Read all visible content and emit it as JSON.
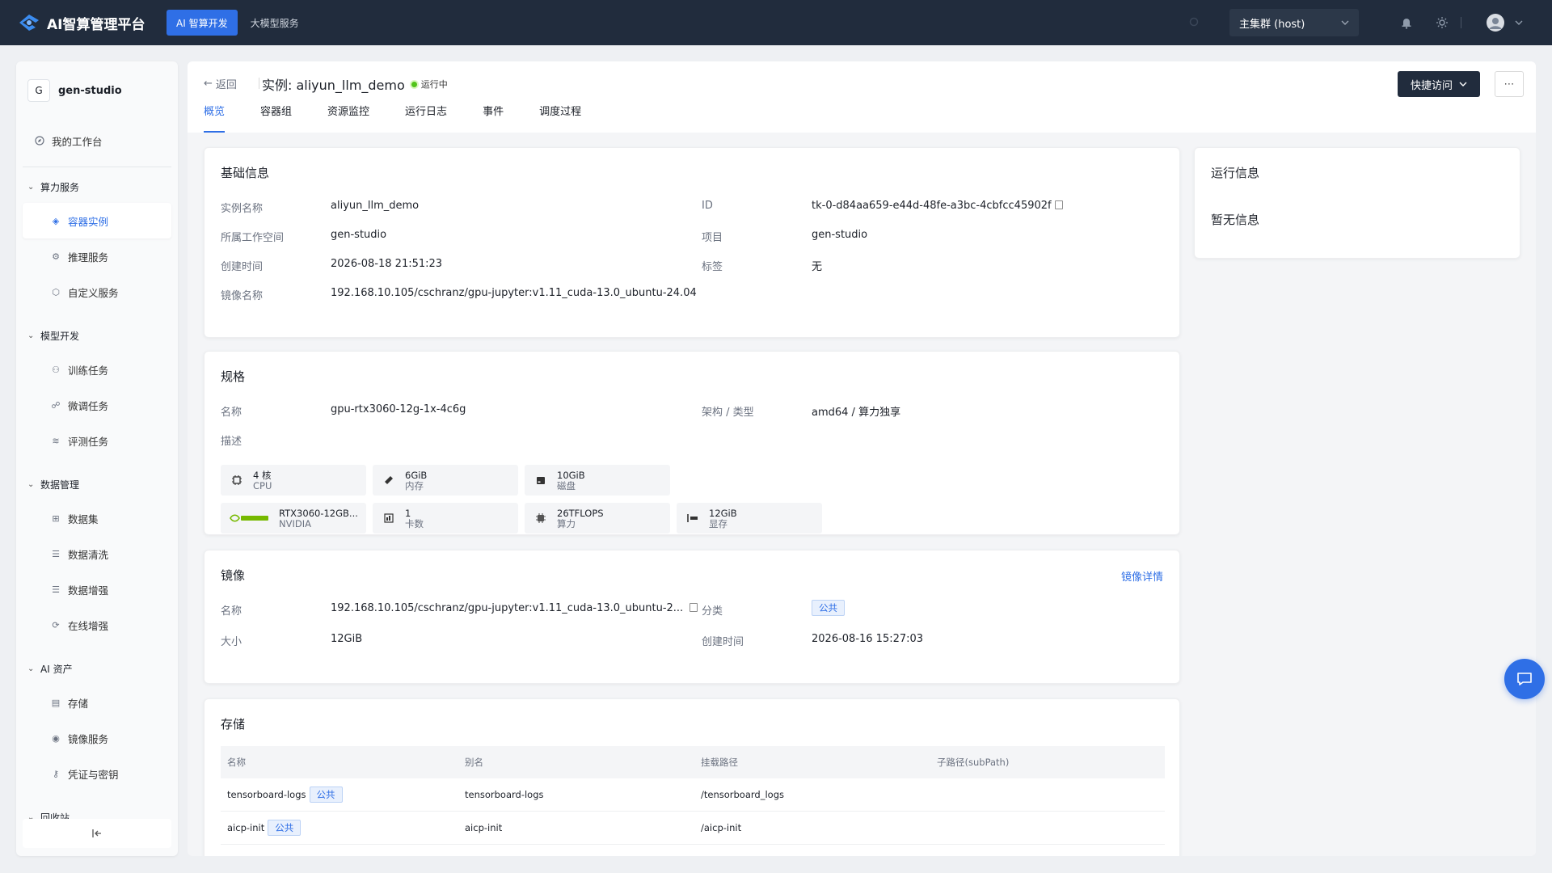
{
  "app": {
    "title": "AI智算管理平台"
  },
  "topnav": {
    "items": [
      {
        "label": "AI 智算开发"
      },
      {
        "label": "大模型服务"
      }
    ]
  },
  "cluster": {
    "label": "主集群 (host)"
  },
  "workspace": {
    "initial": "G",
    "name": "gen-studio"
  },
  "sidebar": {
    "workbench": "我的工作台",
    "groups": [
      {
        "label": "算力服务",
        "items": [
          {
            "label": "容器实例",
            "icon": "cube-icon"
          },
          {
            "label": "推理服务",
            "icon": "gear-icon"
          },
          {
            "label": "自定义服务",
            "icon": "hexagon-icon"
          }
        ]
      },
      {
        "label": "模型开发",
        "items": [
          {
            "label": "训练任务",
            "icon": "hierarchy-icon"
          },
          {
            "label": "微调任务",
            "icon": "tune-icon"
          },
          {
            "label": "评测任务",
            "icon": "layers-icon"
          }
        ]
      },
      {
        "label": "数据管理",
        "items": [
          {
            "label": "数据集",
            "icon": "grid-icon"
          },
          {
            "label": "数据清洗",
            "icon": "list-icon"
          },
          {
            "label": "数据增强",
            "icon": "list-icon"
          },
          {
            "label": "在线增强",
            "icon": "refresh-icon"
          }
        ]
      },
      {
        "label": "AI 资产",
        "items": [
          {
            "label": "存储",
            "icon": "storage-icon"
          },
          {
            "label": "镜像服务",
            "icon": "disc-icon"
          },
          {
            "label": "凭证与密钥",
            "icon": "key-icon"
          }
        ]
      },
      {
        "label": "回收站",
        "items": []
      }
    ]
  },
  "header": {
    "back": "返回",
    "title": "实例: aliyun_llm_demo",
    "status": "运行中",
    "tabs": [
      "概览",
      "容器组",
      "资源监控",
      "运行日志",
      "事件",
      "调度过程"
    ],
    "quick_access": "快捷访问"
  },
  "basic": {
    "title": "基础信息",
    "rows": [
      {
        "label": "实例名称",
        "value": "aliyun_llm_demo"
      },
      {
        "label": "所属工作空间",
        "value": "gen-studio"
      },
      {
        "label": "创建时间",
        "value": "2026-08-18 21:51:23"
      },
      {
        "label": "镜像名称",
        "value": "192.168.10.105/cschranz/gpu-jupyter:v1.11_cuda-13.0_ubuntu-24.04"
      },
      {
        "label": "ID",
        "value": "tk-0-d84aa659-e44d-48fe-a3bc-4cbfcc45902f"
      },
      {
        "label": "项目",
        "value": "gen-studio"
      },
      {
        "label": "标签",
        "value": "无"
      }
    ]
  },
  "runinfo": {
    "title": "运行信息",
    "empty": "暂无信息"
  },
  "spec": {
    "title": "规格",
    "name_label": "名称",
    "name_value": "gpu-rtx3060-12g-1x-4c6g",
    "arch_label": "架构 / 类型",
    "arch_value": "amd64 / 算力独享",
    "desc_label": "描述",
    "resources": [
      {
        "value": "4 核",
        "label": "CPU",
        "icon": "cpu-icon"
      },
      {
        "value": "6GiB",
        "label": "内存",
        "icon": "memory-icon"
      },
      {
        "value": "10GiB",
        "label": "磁盘",
        "icon": "disk-icon"
      },
      {
        "value": "RTX3060-12GB...",
        "label": "NVIDIA",
        "icon": "nvidia-logo"
      },
      {
        "value": "1",
        "label": "卡数",
        "icon": "card-icon"
      },
      {
        "value": "26TFLOPS",
        "label": "算力",
        "icon": "chip-icon"
      },
      {
        "value": "12GiB",
        "label": "显存",
        "icon": "vram-icon"
      }
    ]
  },
  "image": {
    "title": "镜像",
    "detail_link": "镜像详情",
    "name_label": "名称",
    "name_value": "192.168.10.105/cschranz/gpu-jupyter:v1.11_cuda-13.0_ubuntu-2...",
    "cat_label": "分类",
    "cat_value": "公共",
    "size_label": "大小",
    "size_value": "12GiB",
    "ctime_label": "创建时间",
    "ctime_value": "2026-08-16 15:27:03"
  },
  "storage": {
    "title": "存储",
    "columns": [
      "名称",
      "别名",
      "挂载路径",
      "子路径(subPath)"
    ],
    "rows": [
      {
        "name": "tensorboard-logs",
        "tag": "公共",
        "alias": "tensorboard-logs",
        "path": "/tensorboard_logs",
        "subpath": ""
      },
      {
        "name": "aicp-init",
        "tag": "公共",
        "alias": "aicp-init",
        "path": "/aicp-init",
        "subpath": ""
      }
    ]
  },
  "colors": {
    "topbar": "#212c3d",
    "accent": "#2f6fe6",
    "status_green": "#52c41a"
  }
}
